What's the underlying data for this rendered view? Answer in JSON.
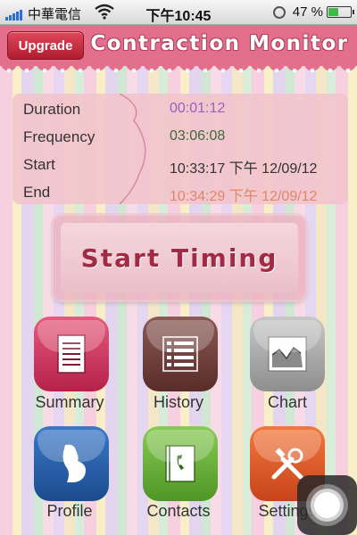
{
  "status_bar": {
    "carrier": "中華電信",
    "time": "下午10:45",
    "battery": "47 %",
    "battery_fraction": 0.47,
    "icons": [
      "signal-icon",
      "wifi-icon",
      "clock-icon",
      "battery-icon"
    ]
  },
  "header": {
    "upgrade_label": "Upgrade",
    "title": "Contraction Monitor"
  },
  "info": {
    "duration_label": "Duration",
    "duration_value": "00:01:12",
    "frequency_label": "Frequency",
    "frequency_value": "03:06:08",
    "start_label": "Start",
    "start_value": "10:33:17 下午 12/09/12",
    "end_label": "End",
    "end_value": "10:34:29 下午 12/09/12"
  },
  "start_button": {
    "label": "Start Timing"
  },
  "menu": {
    "summary": "Summary",
    "history": "History",
    "chart": "Chart",
    "profile": "Profile",
    "contacts": "Contacts",
    "settings": "Settings"
  },
  "colors": {
    "header": "#e36f8d",
    "duration": "#9a5fc2",
    "frequency": "#3e6a3a",
    "end": "#e0866a",
    "start_text": "#a12a45"
  }
}
